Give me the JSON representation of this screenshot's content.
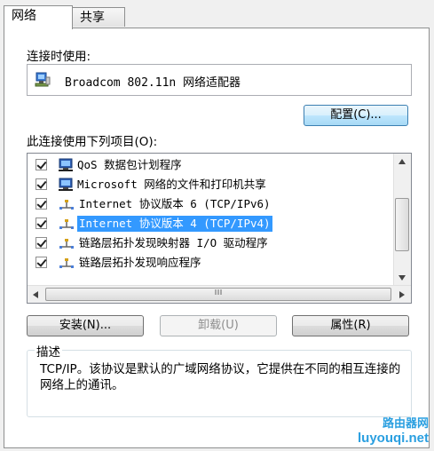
{
  "tabs": [
    {
      "label": "网络"
    },
    {
      "label": "共享"
    }
  ],
  "connect_using_label": "连接时使用:",
  "adapter_name": "Broadcom 802.11n 网络适配器",
  "configure_button": "配置(C)...",
  "items_label": "此连接使用下列项目(O):",
  "items": [
    {
      "label": "QoS 数据包计划程序",
      "icon": "network-client-icon",
      "checked": true
    },
    {
      "label": "Microsoft 网络的文件和打印机共享",
      "icon": "network-client-icon",
      "checked": true
    },
    {
      "label": "Internet 协议版本 6 (TCP/IPv6)",
      "icon": "protocol-icon",
      "checked": true
    },
    {
      "label": "Internet 协议版本 4 (TCP/IPv4)",
      "icon": "protocol-icon",
      "checked": true,
      "selected": true
    },
    {
      "label": "链路层拓扑发现映射器 I/O 驱动程序",
      "icon": "protocol-icon",
      "checked": true
    },
    {
      "label": "链路层拓扑发现响应程序",
      "icon": "protocol-icon",
      "checked": true
    }
  ],
  "buttons": {
    "install": "安装(N)...",
    "uninstall": "卸载(U)",
    "properties": "属性(R)"
  },
  "description_title": "描述",
  "description_text": "TCP/IP。该协议是默认的广域网络协议，它提供在不同的相互连接的网络上的通讯。",
  "watermark": {
    "top": "路由器网",
    "bottom": "luyouqi.net"
  },
  "colors": {
    "selection": "#3399ff",
    "watermark": "#2a9fe0"
  }
}
